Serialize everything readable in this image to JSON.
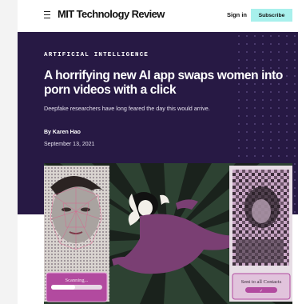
{
  "header": {
    "menu_icon": "menu-icon",
    "logo_text": "MIT Technology Review",
    "signin_label": "Sign in",
    "subscribe_label": "Subscribe",
    "subscribe_color": "#a8f0ec"
  },
  "article": {
    "category": "ARTIFICIAL INTELLIGENCE",
    "title": "A horrifying new AI app swaps women into porn videos with a click",
    "dek": "Deepfake researchers have long feared the day this would arrive.",
    "byline": "By Karen Hao",
    "date": "September 13, 2021",
    "hero_color": "#271944"
  },
  "illustration": {
    "left_phone_label": "Scanning...",
    "right_phone_label": "Sent to all Contacts"
  }
}
